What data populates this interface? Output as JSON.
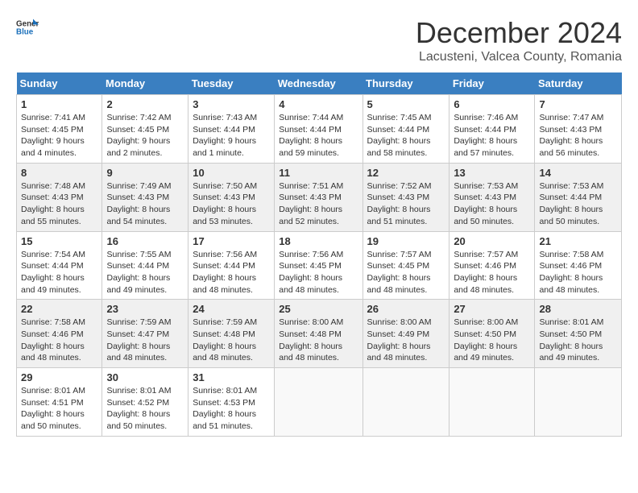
{
  "logo": {
    "text_general": "General",
    "text_blue": "Blue"
  },
  "title": "December 2024",
  "location": "Lacusteni, Valcea County, Romania",
  "days_of_week": [
    "Sunday",
    "Monday",
    "Tuesday",
    "Wednesday",
    "Thursday",
    "Friday",
    "Saturday"
  ],
  "weeks": [
    [
      {
        "day": "1",
        "sunrise": "7:41 AM",
        "sunset": "4:45 PM",
        "daylight": "9 hours and 4 minutes."
      },
      {
        "day": "2",
        "sunrise": "7:42 AM",
        "sunset": "4:45 PM",
        "daylight": "9 hours and 2 minutes."
      },
      {
        "day": "3",
        "sunrise": "7:43 AM",
        "sunset": "4:44 PM",
        "daylight": "9 hours and 1 minute."
      },
      {
        "day": "4",
        "sunrise": "7:44 AM",
        "sunset": "4:44 PM",
        "daylight": "8 hours and 59 minutes."
      },
      {
        "day": "5",
        "sunrise": "7:45 AM",
        "sunset": "4:44 PM",
        "daylight": "8 hours and 58 minutes."
      },
      {
        "day": "6",
        "sunrise": "7:46 AM",
        "sunset": "4:44 PM",
        "daylight": "8 hours and 57 minutes."
      },
      {
        "day": "7",
        "sunrise": "7:47 AM",
        "sunset": "4:43 PM",
        "daylight": "8 hours and 56 minutes."
      }
    ],
    [
      {
        "day": "8",
        "sunrise": "7:48 AM",
        "sunset": "4:43 PM",
        "daylight": "8 hours and 55 minutes."
      },
      {
        "day": "9",
        "sunrise": "7:49 AM",
        "sunset": "4:43 PM",
        "daylight": "8 hours and 54 minutes."
      },
      {
        "day": "10",
        "sunrise": "7:50 AM",
        "sunset": "4:43 PM",
        "daylight": "8 hours and 53 minutes."
      },
      {
        "day": "11",
        "sunrise": "7:51 AM",
        "sunset": "4:43 PM",
        "daylight": "8 hours and 52 minutes."
      },
      {
        "day": "12",
        "sunrise": "7:52 AM",
        "sunset": "4:43 PM",
        "daylight": "8 hours and 51 minutes."
      },
      {
        "day": "13",
        "sunrise": "7:53 AM",
        "sunset": "4:43 PM",
        "daylight": "8 hours and 50 minutes."
      },
      {
        "day": "14",
        "sunrise": "7:53 AM",
        "sunset": "4:44 PM",
        "daylight": "8 hours and 50 minutes."
      }
    ],
    [
      {
        "day": "15",
        "sunrise": "7:54 AM",
        "sunset": "4:44 PM",
        "daylight": "8 hours and 49 minutes."
      },
      {
        "day": "16",
        "sunrise": "7:55 AM",
        "sunset": "4:44 PM",
        "daylight": "8 hours and 49 minutes."
      },
      {
        "day": "17",
        "sunrise": "7:56 AM",
        "sunset": "4:44 PM",
        "daylight": "8 hours and 48 minutes."
      },
      {
        "day": "18",
        "sunrise": "7:56 AM",
        "sunset": "4:45 PM",
        "daylight": "8 hours and 48 minutes."
      },
      {
        "day": "19",
        "sunrise": "7:57 AM",
        "sunset": "4:45 PM",
        "daylight": "8 hours and 48 minutes."
      },
      {
        "day": "20",
        "sunrise": "7:57 AM",
        "sunset": "4:46 PM",
        "daylight": "8 hours and 48 minutes."
      },
      {
        "day": "21",
        "sunrise": "7:58 AM",
        "sunset": "4:46 PM",
        "daylight": "8 hours and 48 minutes."
      }
    ],
    [
      {
        "day": "22",
        "sunrise": "7:58 AM",
        "sunset": "4:46 PM",
        "daylight": "8 hours and 48 minutes."
      },
      {
        "day": "23",
        "sunrise": "7:59 AM",
        "sunset": "4:47 PM",
        "daylight": "8 hours and 48 minutes."
      },
      {
        "day": "24",
        "sunrise": "7:59 AM",
        "sunset": "4:48 PM",
        "daylight": "8 hours and 48 minutes."
      },
      {
        "day": "25",
        "sunrise": "8:00 AM",
        "sunset": "4:48 PM",
        "daylight": "8 hours and 48 minutes."
      },
      {
        "day": "26",
        "sunrise": "8:00 AM",
        "sunset": "4:49 PM",
        "daylight": "8 hours and 48 minutes."
      },
      {
        "day": "27",
        "sunrise": "8:00 AM",
        "sunset": "4:50 PM",
        "daylight": "8 hours and 49 minutes."
      },
      {
        "day": "28",
        "sunrise": "8:01 AM",
        "sunset": "4:50 PM",
        "daylight": "8 hours and 49 minutes."
      }
    ],
    [
      {
        "day": "29",
        "sunrise": "8:01 AM",
        "sunset": "4:51 PM",
        "daylight": "8 hours and 50 minutes."
      },
      {
        "day": "30",
        "sunrise": "8:01 AM",
        "sunset": "4:52 PM",
        "daylight": "8 hours and 50 minutes."
      },
      {
        "day": "31",
        "sunrise": "8:01 AM",
        "sunset": "4:53 PM",
        "daylight": "8 hours and 51 minutes."
      },
      null,
      null,
      null,
      null
    ]
  ]
}
